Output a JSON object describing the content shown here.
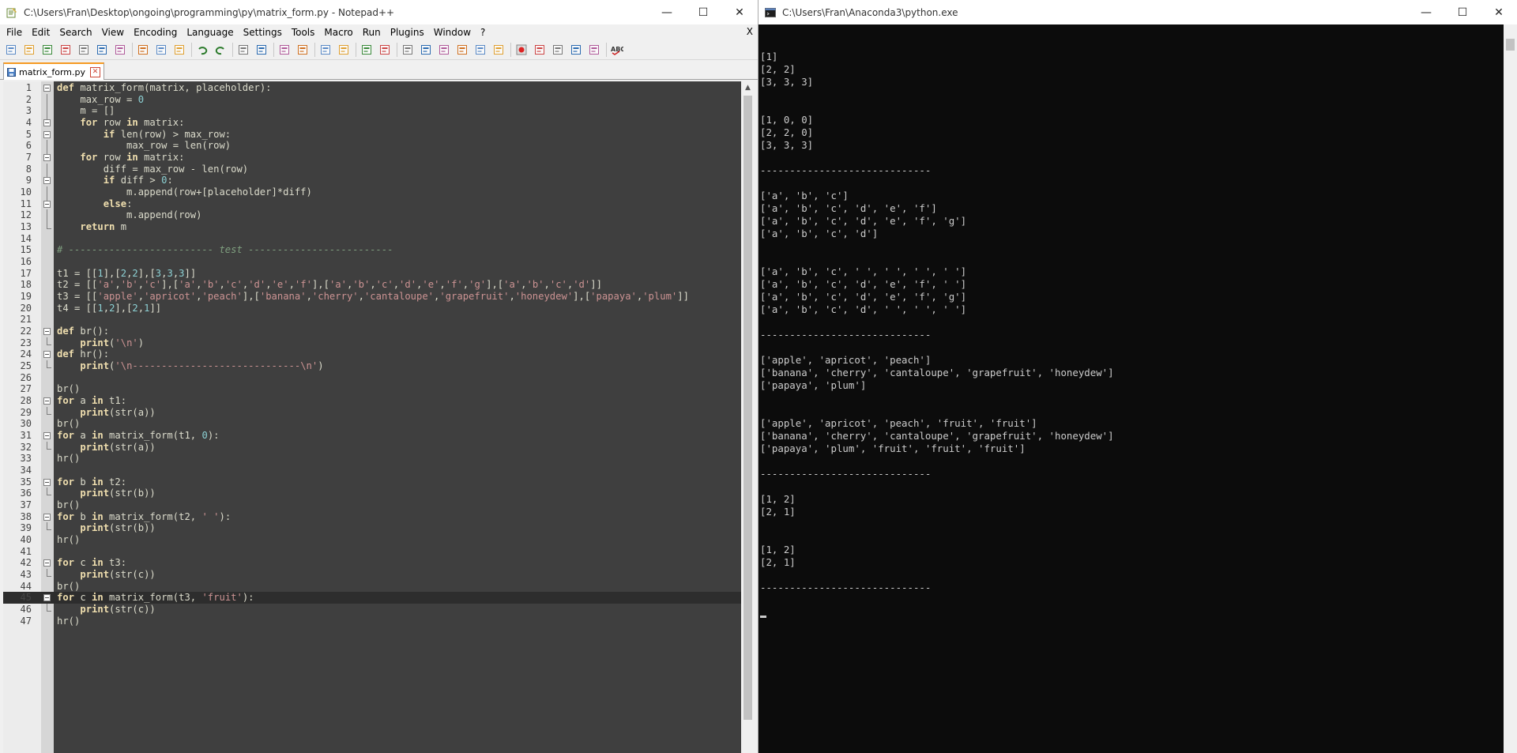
{
  "editor_window": {
    "title": "C:\\Users\\Fran\\Desktop\\ongoing\\programming\\py\\matrix_form.py - Notepad++",
    "menu": [
      "File",
      "Edit",
      "Search",
      "View",
      "Encoding",
      "Language",
      "Settings",
      "Tools",
      "Macro",
      "Run",
      "Plugins",
      "Window",
      "?"
    ],
    "menu_close": "X",
    "tab_label": "matrix_form.py",
    "minimize_glyph": "—",
    "maximize_glyph": "☐",
    "close_glyph": "✕",
    "accent_color": "#f59a23"
  },
  "toolbar_icons": [
    "new-file-icon",
    "open-file-icon",
    "save-icon",
    "save-all-icon",
    "close-icon",
    "close-all-icon",
    "print-icon",
    "cut-icon",
    "copy-icon",
    "paste-icon",
    "undo-icon",
    "redo-icon",
    "find-icon",
    "replace-icon",
    "zoom-in-icon",
    "zoom-out-icon",
    "sync-vertical-icon",
    "sync-horizontal-icon",
    "word-wrap-icon",
    "show-all-chars-icon",
    "indent-guide-icon",
    "user-language-icon",
    "doc-map-icon",
    "function-list-icon",
    "folder-workspace-icon",
    "monitoring-icon",
    "record-macro-icon",
    "stop-record-icon",
    "play-macro-icon",
    "run-macro-multiple-icon",
    "save-macro-icon",
    "spell-check-icon"
  ],
  "code_lines": [
    [
      {
        "t": "kw",
        "v": "def"
      },
      {
        "t": "p",
        "v": " matrix_form(matrix, placeholder):"
      }
    ],
    [
      {
        "t": "p",
        "v": "    max_row = "
      },
      {
        "t": "num",
        "v": "0"
      }
    ],
    [
      {
        "t": "p",
        "v": "    m = []"
      }
    ],
    [
      {
        "t": "p",
        "v": "    "
      },
      {
        "t": "kw",
        "v": "for"
      },
      {
        "t": "p",
        "v": " row "
      },
      {
        "t": "kw",
        "v": "in"
      },
      {
        "t": "p",
        "v": " matrix:"
      }
    ],
    [
      {
        "t": "p",
        "v": "        "
      },
      {
        "t": "kw",
        "v": "if"
      },
      {
        "t": "p",
        "v": " len(row) > max_row:"
      }
    ],
    [
      {
        "t": "p",
        "v": "            max_row = len(row)"
      }
    ],
    [
      {
        "t": "p",
        "v": "    "
      },
      {
        "t": "kw",
        "v": "for"
      },
      {
        "t": "p",
        "v": " row "
      },
      {
        "t": "kw",
        "v": "in"
      },
      {
        "t": "p",
        "v": " matrix:"
      }
    ],
    [
      {
        "t": "p",
        "v": "        diff = max_row - len(row)"
      }
    ],
    [
      {
        "t": "p",
        "v": "        "
      },
      {
        "t": "kw",
        "v": "if"
      },
      {
        "t": "p",
        "v": " diff > "
      },
      {
        "t": "num",
        "v": "0"
      },
      {
        "t": "p",
        "v": ":"
      }
    ],
    [
      {
        "t": "p",
        "v": "            m.append(row+[placeholder]*diff)"
      }
    ],
    [
      {
        "t": "p",
        "v": "        "
      },
      {
        "t": "kw",
        "v": "else"
      },
      {
        "t": "p",
        "v": ":"
      }
    ],
    [
      {
        "t": "p",
        "v": "            m.append(row)"
      }
    ],
    [
      {
        "t": "p",
        "v": "    "
      },
      {
        "t": "kw",
        "v": "return"
      },
      {
        "t": "p",
        "v": " m"
      }
    ],
    [],
    [
      {
        "t": "cmt",
        "v": "# ------------------------- test -------------------------"
      }
    ],
    [],
    [
      {
        "t": "p",
        "v": "t1 = [["
      },
      {
        "t": "num",
        "v": "1"
      },
      {
        "t": "p",
        "v": "],["
      },
      {
        "t": "num",
        "v": "2"
      },
      {
        "t": "p",
        "v": ","
      },
      {
        "t": "num",
        "v": "2"
      },
      {
        "t": "p",
        "v": "],["
      },
      {
        "t": "num",
        "v": "3"
      },
      {
        "t": "p",
        "v": ","
      },
      {
        "t": "num",
        "v": "3"
      },
      {
        "t": "p",
        "v": ","
      },
      {
        "t": "num",
        "v": "3"
      },
      {
        "t": "p",
        "v": "]]"
      }
    ],
    [
      {
        "t": "p",
        "v": "t2 = [["
      },
      {
        "t": "str",
        "v": "'a'"
      },
      {
        "t": "p",
        "v": ","
      },
      {
        "t": "str",
        "v": "'b'"
      },
      {
        "t": "p",
        "v": ","
      },
      {
        "t": "str",
        "v": "'c'"
      },
      {
        "t": "p",
        "v": "],["
      },
      {
        "t": "str",
        "v": "'a'"
      },
      {
        "t": "p",
        "v": ","
      },
      {
        "t": "str",
        "v": "'b'"
      },
      {
        "t": "p",
        "v": ","
      },
      {
        "t": "str",
        "v": "'c'"
      },
      {
        "t": "p",
        "v": ","
      },
      {
        "t": "str",
        "v": "'d'"
      },
      {
        "t": "p",
        "v": ","
      },
      {
        "t": "str",
        "v": "'e'"
      },
      {
        "t": "p",
        "v": ","
      },
      {
        "t": "str",
        "v": "'f'"
      },
      {
        "t": "p",
        "v": "],["
      },
      {
        "t": "str",
        "v": "'a'"
      },
      {
        "t": "p",
        "v": ","
      },
      {
        "t": "str",
        "v": "'b'"
      },
      {
        "t": "p",
        "v": ","
      },
      {
        "t": "str",
        "v": "'c'"
      },
      {
        "t": "p",
        "v": ","
      },
      {
        "t": "str",
        "v": "'d'"
      },
      {
        "t": "p",
        "v": ","
      },
      {
        "t": "str",
        "v": "'e'"
      },
      {
        "t": "p",
        "v": ","
      },
      {
        "t": "str",
        "v": "'f'"
      },
      {
        "t": "p",
        "v": ","
      },
      {
        "t": "str",
        "v": "'g'"
      },
      {
        "t": "p",
        "v": "],["
      },
      {
        "t": "str",
        "v": "'a'"
      },
      {
        "t": "p",
        "v": ","
      },
      {
        "t": "str",
        "v": "'b'"
      },
      {
        "t": "p",
        "v": ","
      },
      {
        "t": "str",
        "v": "'c'"
      },
      {
        "t": "p",
        "v": ","
      },
      {
        "t": "str",
        "v": "'d'"
      },
      {
        "t": "p",
        "v": "]]"
      }
    ],
    [
      {
        "t": "p",
        "v": "t3 = [["
      },
      {
        "t": "str",
        "v": "'apple'"
      },
      {
        "t": "p",
        "v": ","
      },
      {
        "t": "str",
        "v": "'apricot'"
      },
      {
        "t": "p",
        "v": ","
      },
      {
        "t": "str",
        "v": "'peach'"
      },
      {
        "t": "p",
        "v": "],["
      },
      {
        "t": "str",
        "v": "'banana'"
      },
      {
        "t": "p",
        "v": ","
      },
      {
        "t": "str",
        "v": "'cherry'"
      },
      {
        "t": "p",
        "v": ","
      },
      {
        "t": "str",
        "v": "'cantaloupe'"
      },
      {
        "t": "p",
        "v": ","
      },
      {
        "t": "str",
        "v": "'grapefruit'"
      },
      {
        "t": "p",
        "v": ","
      },
      {
        "t": "str",
        "v": "'honeydew'"
      },
      {
        "t": "p",
        "v": "],["
      },
      {
        "t": "str",
        "v": "'papaya'"
      },
      {
        "t": "p",
        "v": ","
      },
      {
        "t": "str",
        "v": "'plum'"
      },
      {
        "t": "p",
        "v": "]]"
      }
    ],
    [
      {
        "t": "p",
        "v": "t4 = [["
      },
      {
        "t": "num",
        "v": "1"
      },
      {
        "t": "p",
        "v": ","
      },
      {
        "t": "num",
        "v": "2"
      },
      {
        "t": "p",
        "v": "],["
      },
      {
        "t": "num",
        "v": "2"
      },
      {
        "t": "p",
        "v": ","
      },
      {
        "t": "num",
        "v": "1"
      },
      {
        "t": "p",
        "v": "]]"
      }
    ],
    [],
    [
      {
        "t": "kw",
        "v": "def"
      },
      {
        "t": "p",
        "v": " br():"
      }
    ],
    [
      {
        "t": "p",
        "v": "    "
      },
      {
        "t": "kw",
        "v": "print"
      },
      {
        "t": "p",
        "v": "("
      },
      {
        "t": "str",
        "v": "'\\n'"
      },
      {
        "t": "p",
        "v": ")"
      }
    ],
    [
      {
        "t": "kw",
        "v": "def"
      },
      {
        "t": "p",
        "v": " hr():"
      }
    ],
    [
      {
        "t": "p",
        "v": "    "
      },
      {
        "t": "kw",
        "v": "print"
      },
      {
        "t": "p",
        "v": "("
      },
      {
        "t": "str",
        "v": "'\\n-----------------------------\\n'"
      },
      {
        "t": "p",
        "v": ")"
      }
    ],
    [],
    [
      {
        "t": "p",
        "v": "br()"
      }
    ],
    [
      {
        "t": "kw",
        "v": "for"
      },
      {
        "t": "p",
        "v": " a "
      },
      {
        "t": "kw",
        "v": "in"
      },
      {
        "t": "p",
        "v": " t1:"
      }
    ],
    [
      {
        "t": "p",
        "v": "    "
      },
      {
        "t": "kw",
        "v": "print"
      },
      {
        "t": "p",
        "v": "(str(a))"
      }
    ],
    [
      {
        "t": "p",
        "v": "br()"
      }
    ],
    [
      {
        "t": "kw",
        "v": "for"
      },
      {
        "t": "p",
        "v": " a "
      },
      {
        "t": "kw",
        "v": "in"
      },
      {
        "t": "p",
        "v": " matrix_form(t1, "
      },
      {
        "t": "num",
        "v": "0"
      },
      {
        "t": "p",
        "v": "):"
      }
    ],
    [
      {
        "t": "p",
        "v": "    "
      },
      {
        "t": "kw",
        "v": "print"
      },
      {
        "t": "p",
        "v": "(str(a))"
      }
    ],
    [
      {
        "t": "p",
        "v": "hr()"
      }
    ],
    [],
    [
      {
        "t": "kw",
        "v": "for"
      },
      {
        "t": "p",
        "v": " b "
      },
      {
        "t": "kw",
        "v": "in"
      },
      {
        "t": "p",
        "v": " t2:"
      }
    ],
    [
      {
        "t": "p",
        "v": "    "
      },
      {
        "t": "kw",
        "v": "print"
      },
      {
        "t": "p",
        "v": "(str(b))"
      }
    ],
    [
      {
        "t": "p",
        "v": "br()"
      }
    ],
    [
      {
        "t": "kw",
        "v": "for"
      },
      {
        "t": "p",
        "v": " b "
      },
      {
        "t": "kw",
        "v": "in"
      },
      {
        "t": "p",
        "v": " matrix_form(t2, "
      },
      {
        "t": "str",
        "v": "' '"
      },
      {
        "t": "p",
        "v": "):"
      }
    ],
    [
      {
        "t": "p",
        "v": "    "
      },
      {
        "t": "kw",
        "v": "print"
      },
      {
        "t": "p",
        "v": "(str(b))"
      }
    ],
    [
      {
        "t": "p",
        "v": "hr()"
      }
    ],
    [],
    [
      {
        "t": "kw",
        "v": "for"
      },
      {
        "t": "p",
        "v": " c "
      },
      {
        "t": "kw",
        "v": "in"
      },
      {
        "t": "p",
        "v": " t3:"
      }
    ],
    [
      {
        "t": "p",
        "v": "    "
      },
      {
        "t": "kw",
        "v": "print"
      },
      {
        "t": "p",
        "v": "(str(c))"
      }
    ],
    [
      {
        "t": "p",
        "v": "br()"
      }
    ],
    [
      {
        "t": "kw",
        "v": "for"
      },
      {
        "t": "p",
        "v": " c "
      },
      {
        "t": "kw",
        "v": "in"
      },
      {
        "t": "p",
        "v": " matrix_form(t3, "
      },
      {
        "t": "str",
        "v": "'fruit'"
      },
      {
        "t": "p",
        "v": "):"
      }
    ],
    [
      {
        "t": "p",
        "v": "    "
      },
      {
        "t": "kw",
        "v": "print"
      },
      {
        "t": "p",
        "v": "(str(c))"
      }
    ],
    [
      {
        "t": "p",
        "v": "hr()"
      }
    ]
  ],
  "current_line": 45,
  "folds": {
    "1": "box",
    "2": "v",
    "3": "v",
    "4": "box",
    "5": "box",
    "6": "v",
    "7": "box",
    "8": "v",
    "9": "box",
    "10": "v",
    "11": "box",
    "12": "v",
    "13": "end",
    "22": "box",
    "23": "end",
    "24": "box",
    "25": "end",
    "28": "box",
    "29": "end",
    "31": "box",
    "32": "end",
    "35": "box",
    "36": "end",
    "38": "box",
    "39": "end",
    "42": "box",
    "43": "end",
    "45": "box",
    "46": "end"
  },
  "console_window": {
    "title": "C:\\Users\\Fran\\Anaconda3\\python.exe",
    "minimize_glyph": "—",
    "maximize_glyph": "☐",
    "close_glyph": "✕",
    "output": [
      "",
      "",
      "[1]",
      "[2, 2]",
      "[3, 3, 3]",
      "",
      "",
      "[1, 0, 0]",
      "[2, 2, 0]",
      "[3, 3, 3]",
      "",
      "-----------------------------",
      "",
      "['a', 'b', 'c']",
      "['a', 'b', 'c', 'd', 'e', 'f']",
      "['a', 'b', 'c', 'd', 'e', 'f', 'g']",
      "['a', 'b', 'c', 'd']",
      "",
      "",
      "['a', 'b', 'c', ' ', ' ', ' ', ' ']",
      "['a', 'b', 'c', 'd', 'e', 'f', ' ']",
      "['a', 'b', 'c', 'd', 'e', 'f', 'g']",
      "['a', 'b', 'c', 'd', ' ', ' ', ' ']",
      "",
      "-----------------------------",
      "",
      "['apple', 'apricot', 'peach']",
      "['banana', 'cherry', 'cantaloupe', 'grapefruit', 'honeydew']",
      "['papaya', 'plum']",
      "",
      "",
      "['apple', 'apricot', 'peach', 'fruit', 'fruit']",
      "['banana', 'cherry', 'cantaloupe', 'grapefruit', 'honeydew']",
      "['papaya', 'plum', 'fruit', 'fruit', 'fruit']",
      "",
      "-----------------------------",
      "",
      "[1, 2]",
      "[2, 1]",
      "",
      "",
      "[1, 2]",
      "[2, 1]",
      "",
      "-----------------------------",
      ""
    ]
  }
}
